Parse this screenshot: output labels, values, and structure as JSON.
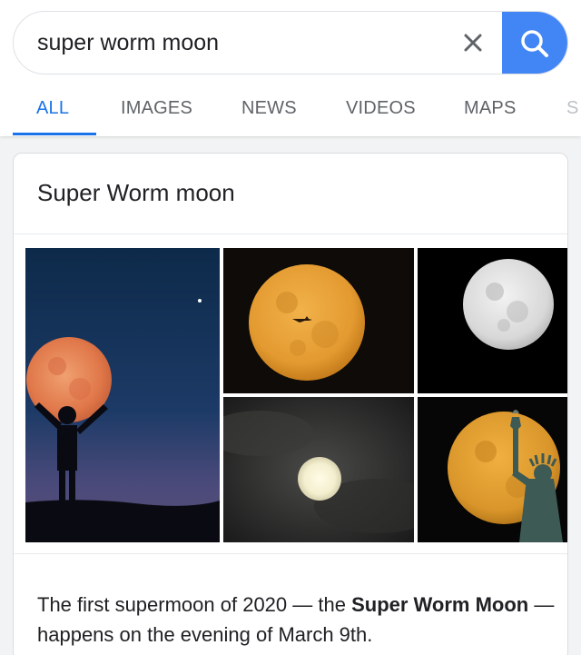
{
  "search": {
    "query": "super worm moon"
  },
  "tabs": [
    {
      "label": "ALL",
      "active": true
    },
    {
      "label": "IMAGES"
    },
    {
      "label": "NEWS"
    },
    {
      "label": "VIDEOS"
    },
    {
      "label": "MAPS"
    },
    {
      "label": "S"
    }
  ],
  "card": {
    "title": "Super Worm moon",
    "snippet": {
      "part1": "The first supermoon of 2020 — the ",
      "bold1": "Super Worm Moon",
      "part2": " — happens on the evening of March 9th."
    }
  },
  "colors": {
    "accent": "#1a73e8",
    "search_button": "#4285f4"
  },
  "icons": {
    "clear": "close-icon",
    "search": "search-icon"
  }
}
